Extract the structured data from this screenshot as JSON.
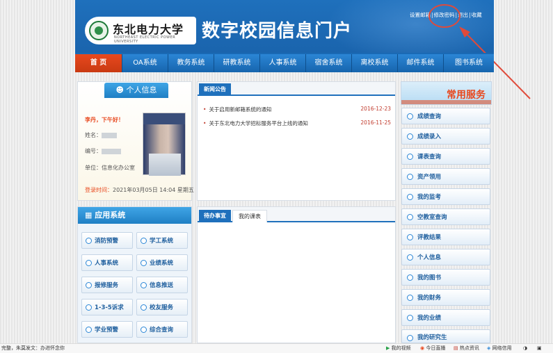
{
  "header": {
    "logo_cn": "东北电力大学",
    "logo_en": "NORTHEAST ELECTRIC POWER UNIVERSITY",
    "portal_title": "数字校园信息门户",
    "top_links": [
      "设置邮箱",
      "修改密码",
      "退出",
      "收藏"
    ]
  },
  "nav": {
    "items": [
      "首 页",
      "OA系统",
      "教务系统",
      "研教系统",
      "人事系统",
      "宿舍系统",
      "离校系统",
      "邮件系统",
      "图书系统"
    ],
    "active": 0
  },
  "personal": {
    "title": "个人信息",
    "greeting": "李丹，下午好！",
    "name_label": "姓名：",
    "id_label": "编号：",
    "unit_label": "单位：信息化办公室",
    "login_label": "登录时间：",
    "login_value": "2021年03月05日 14:04 星期五"
  },
  "news": {
    "tab": "新闻公告",
    "items": [
      {
        "title": "关于启用新邮箱系统的通知",
        "date": "2016-12-23"
      },
      {
        "title": "关于东北电力大学招标服务平台上线的通知",
        "date": "2016-11-25"
      }
    ]
  },
  "apps": {
    "title": "应用系统",
    "items": [
      "消防预警",
      "学工系统",
      "人事系统",
      "业绩系统",
      "报修服务",
      "信息推送",
      "1-3-5诉求",
      "校友服务",
      "学业预警",
      "综合查询"
    ]
  },
  "todo": {
    "tabs": [
      "待办事宜",
      "我的课表"
    ]
  },
  "services": {
    "title": "常用服务",
    "items": [
      "成绩查询",
      "成绩录入",
      "课表查询",
      "资产领用",
      "我的监考",
      "空教室查询",
      "评教结果",
      "个人信息",
      "我的图书",
      "我的财务",
      "我的业绩",
      "我的研究生"
    ]
  },
  "statusbar": {
    "left": "完整，朱莫发文：办进怀念你",
    "items": [
      "我的视频",
      "今日直播",
      "热点资讯",
      "网络信用"
    ]
  },
  "colors": {
    "header_blue": "#1f70bc",
    "nav_active": "#e8481e",
    "accent_red": "#c0392b"
  }
}
